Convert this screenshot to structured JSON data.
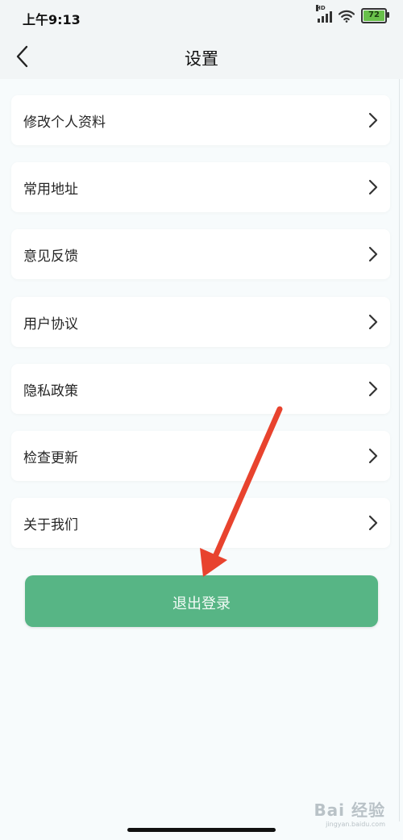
{
  "status_bar": {
    "time": "上午9:13",
    "network": "HD",
    "battery_level": "72",
    "icons": [
      "signal-icon",
      "wifi-icon",
      "battery-icon"
    ]
  },
  "header": {
    "back_icon": "chevron-left-icon",
    "title": "设置"
  },
  "menu": {
    "items": [
      {
        "label": "修改个人资料",
        "icon": "chevron-right-icon"
      },
      {
        "label": "常用地址",
        "icon": "chevron-right-icon"
      },
      {
        "label": "意见反馈",
        "icon": "chevron-right-icon"
      },
      {
        "label": "用户协议",
        "icon": "chevron-right-icon"
      },
      {
        "label": "隐私政策",
        "icon": "chevron-right-icon"
      },
      {
        "label": "检查更新",
        "icon": "chevron-right-icon"
      },
      {
        "label": "关于我们",
        "icon": "chevron-right-icon"
      }
    ]
  },
  "logout": {
    "label": "退出登录"
  },
  "watermark": {
    "brand": "Bai 经验",
    "url": "jingyan.baidu.com"
  },
  "colors": {
    "button_green": "#57b585",
    "arrow_red": "#e8432e",
    "background": "#f7fbfc"
  }
}
